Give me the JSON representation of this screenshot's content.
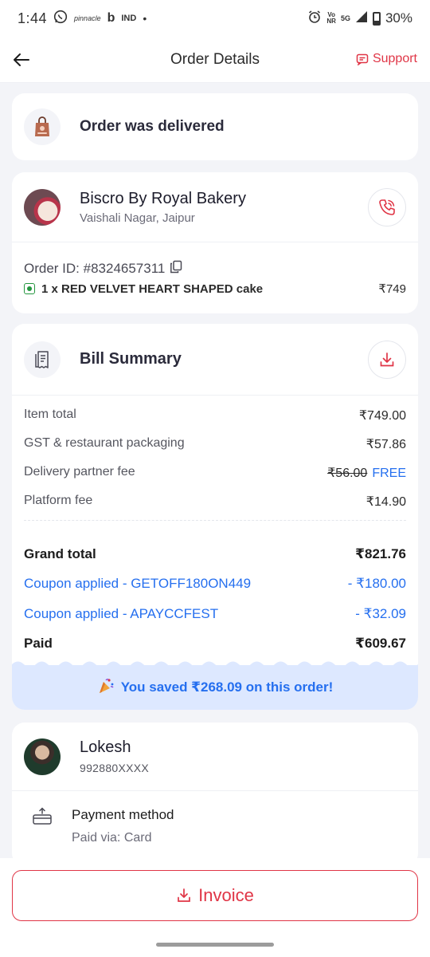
{
  "status_bar": {
    "time": "1:44",
    "app_icons": [
      "whatsapp-icon",
      "pinnacle-icon",
      "bing-icon",
      "ind-icon"
    ],
    "pinnacle_label": "pinnacle",
    "bing_label": "b",
    "ind_label": "IND",
    "dot": "•",
    "volte": "Vo",
    "nr": "NR",
    "network": "5G",
    "battery": "30%"
  },
  "header": {
    "title": "Order Details",
    "support_label": "Support"
  },
  "delivery": {
    "status": "Order was delivered"
  },
  "restaurant": {
    "name": "Biscro By Royal Bakery",
    "location": "Vaishali Nagar, Jaipur",
    "order_id": "Order ID: #8324657311",
    "items": [
      {
        "label": "1 x RED VELVET HEART SHAPED cake",
        "price": "₹749"
      }
    ]
  },
  "bill": {
    "title": "Bill Summary",
    "rows": [
      {
        "label": "Item total",
        "value": "₹749.00"
      },
      {
        "label": "GST & restaurant packaging",
        "value": "₹57.86"
      },
      {
        "label": "Delivery partner fee",
        "original": "₹56.00",
        "value": "FREE"
      },
      {
        "label": "Platform fee",
        "value": "₹14.90"
      }
    ],
    "grand_total": {
      "label": "Grand total",
      "value": "₹821.76"
    },
    "coupons": [
      {
        "label": "Coupon applied - GETOFF180ON449",
        "value": "- ₹180.00"
      },
      {
        "label": "Coupon applied - APAYCCFEST",
        "value": "- ₹32.09"
      }
    ],
    "paid": {
      "label": "Paid",
      "value": "₹609.67"
    },
    "saved_text": "You saved ₹268.09 on this order!"
  },
  "customer": {
    "name": "Lokesh",
    "phone": "992880XXXX"
  },
  "payment": {
    "title": "Payment method",
    "subtitle": "Paid via: Card"
  },
  "footer": {
    "invoice_label": "Invoice"
  },
  "colors": {
    "accent_red": "#e03546",
    "link_blue": "#256fef",
    "veg_green": "#24963f"
  }
}
